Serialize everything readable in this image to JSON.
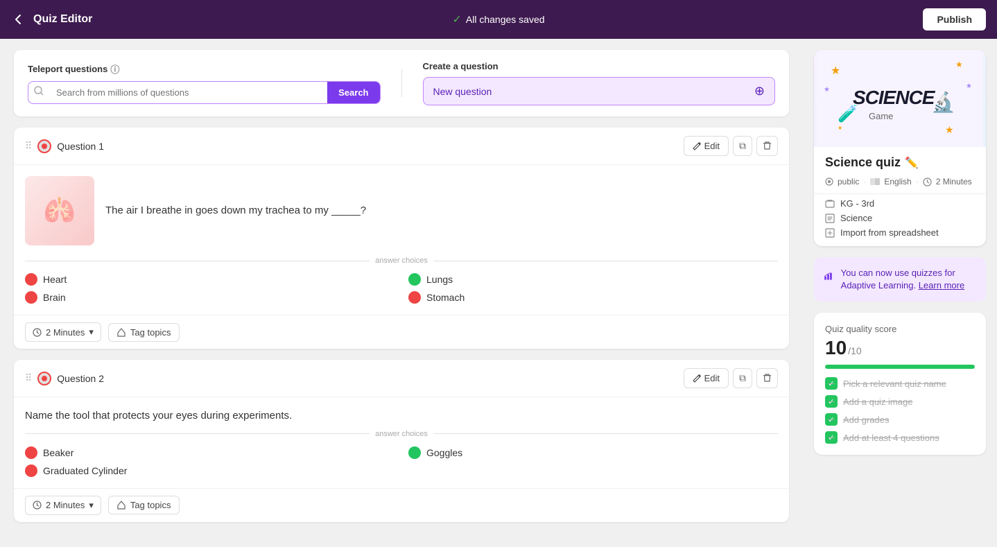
{
  "header": {
    "title": "Quiz Editor",
    "status": "All changes saved",
    "publish_label": "Publish",
    "back_icon": "‹"
  },
  "teleport": {
    "label": "Teleport questions",
    "search_placeholder": "Search from millions of questions",
    "search_button": "Search"
  },
  "create": {
    "label": "Create a question",
    "new_question_button": "New question"
  },
  "questions": [
    {
      "id": "q1",
      "label": "Question 1",
      "text": "The air I breathe in goes down my trachea to my _____?",
      "has_image": true,
      "image_emoji": "🫁",
      "answer_choices_label": "answer choices",
      "answers": [
        {
          "label": "Heart",
          "correct": false
        },
        {
          "label": "Lungs",
          "correct": true
        },
        {
          "label": "Brain",
          "correct": false
        },
        {
          "label": "Stomach",
          "correct": false
        }
      ],
      "time": "2 Minutes",
      "tag_topics": "Tag topics",
      "edit_label": "Edit",
      "copy_icon": "⧉",
      "delete_icon": "🗑"
    },
    {
      "id": "q2",
      "label": "Question 2",
      "text": "Name the tool that protects your eyes during experiments.",
      "has_image": false,
      "answer_choices_label": "answer choices",
      "answers": [
        {
          "label": "Beaker",
          "correct": false
        },
        {
          "label": "Goggles",
          "correct": true
        },
        {
          "label": "Graduated Cylinder",
          "correct": false
        }
      ],
      "time": "2 Minutes",
      "tag_topics": "Tag topics",
      "edit_label": "Edit",
      "copy_icon": "⧉",
      "delete_icon": "🗑"
    }
  ],
  "sidebar": {
    "quiz_title": "Science quiz",
    "edit_icon": "✏️",
    "meta": {
      "visibility": "public",
      "language": "English",
      "duration": "2 Minutes"
    },
    "grade": "KG - 3rd",
    "subject": "Science",
    "import": "Import from spreadsheet",
    "adaptive_banner": {
      "text": "You can now use quizzes for Adaptive Learning.",
      "link": "Learn more"
    },
    "quality": {
      "label": "Quiz quality score",
      "score": "10",
      "max": "/10",
      "bar_percent": 100,
      "checklist": [
        "Pick a relevant quiz name",
        "Add a quiz image",
        "Add grades",
        "Add at least 4 questions"
      ]
    }
  }
}
